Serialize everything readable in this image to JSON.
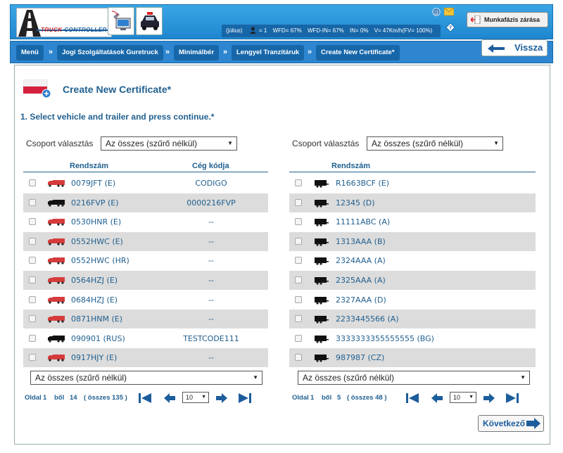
{
  "header": {
    "logo_text_a": "TRUCK",
    "logo_text_b": "CONTROLLER",
    "stats": {
      "month": "(július)",
      "users": "= 1",
      "wfd": "WFD= 67%",
      "wfd_in": "WFD-IN= 67%",
      "in": "IN= 0%",
      "v": "V= 47Km/h(FV= 100%)"
    },
    "close_phase_label": "Munkafázis zárása"
  },
  "breadcrumb": {
    "items": [
      "Menü",
      "Jogi Szolgáltatások Guretruck",
      "Minimálbér",
      "Lengyel Tranzitáruk",
      "Create New Certificate*"
    ],
    "separator": "»"
  },
  "back_label": "Vissza",
  "page": {
    "title": "Create New Certificate*",
    "step": "1. Select vehicle and trailer and press continue.*"
  },
  "left": {
    "group_label": "Csoport választás",
    "group_value": "Az összes (szűrő nélkül)",
    "col_plate": "Rendszám",
    "col_code": "Cég kódja",
    "rows": [
      {
        "plate": "0079JFT (E)",
        "code": "CODIGO",
        "icon": "red"
      },
      {
        "plate": "0216FVP (E)",
        "code": "0000216FVP",
        "icon": "black"
      },
      {
        "plate": "0530HNR (E)",
        "code": "--",
        "icon": "red"
      },
      {
        "plate": "0552HWC (E)",
        "code": "--",
        "icon": "red"
      },
      {
        "plate": "0552HWC (HR)",
        "code": "--",
        "icon": "red"
      },
      {
        "plate": "0564HZJ (E)",
        "code": "--",
        "icon": "red"
      },
      {
        "plate": "0684HZJ (E)",
        "code": "--",
        "icon": "red"
      },
      {
        "plate": "0871HNM (E)",
        "code": "--",
        "icon": "red"
      },
      {
        "plate": "090901 (RUS)",
        "code": "TESTCODE111",
        "icon": "black"
      },
      {
        "plate": "0917HJY (E)",
        "code": "--",
        "icon": "red"
      }
    ],
    "filter_value": "Az összes (szűrő nélkül)",
    "pager": {
      "page_label": "Oldal",
      "page": "1",
      "of_label": "ből",
      "pages": "14",
      "total": "( összes 135 )",
      "per_page": "10"
    }
  },
  "right": {
    "group_label": "Csoport választás",
    "group_value": "Az összes (szűrő nélkül)",
    "col_plate": "Rendszám",
    "rows": [
      {
        "plate": "R1663BCF (E)"
      },
      {
        "plate": "12345 (D)"
      },
      {
        "plate": "11111ABC (A)"
      },
      {
        "plate": "1313AAA (B)"
      },
      {
        "plate": "2324AAA (A)"
      },
      {
        "plate": "2325AAA (A)"
      },
      {
        "plate": "2327AAA (D)"
      },
      {
        "plate": "2233445566 (A)"
      },
      {
        "plate": "3333333355555555 (BG)"
      },
      {
        "plate": "987987 (CZ)"
      }
    ],
    "filter_value": "Az összes (szűrő nélkül)",
    "pager": {
      "page_label": "Oldal",
      "page": "1",
      "of_label": "ből",
      "pages": "5",
      "total": "( összes 48 )",
      "per_page": "10"
    }
  },
  "next_label": "Következő"
}
